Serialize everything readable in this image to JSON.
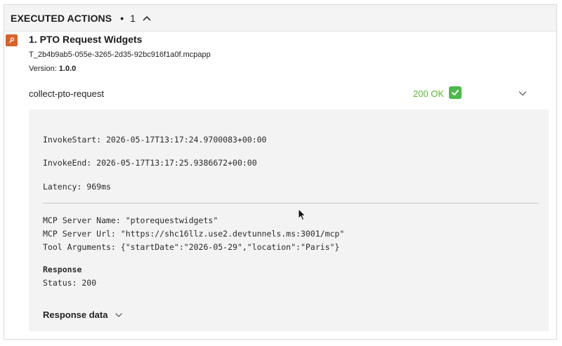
{
  "header": {
    "title": "EXECUTED ACTIONS",
    "dot": "•",
    "count": "1"
  },
  "app": {
    "title": "1. PTO Request Widgets",
    "id": "T_2b4b9ab5-055e-3265-2d35-92bc916f1a0f.mcpapp",
    "version_label": "Version: ",
    "version_value": "1.0.0",
    "icon": "orange-app-icon"
  },
  "action": {
    "name": "collect-pto-request",
    "status": "200 OK",
    "status_color": "#5db73a"
  },
  "details": {
    "invoke_start": "InvokeStart: 2026-05-17T13:17:24.9700083+00:00",
    "invoke_end": "InvokeEnd: 2026-05-17T13:17:25.9386672+00:00",
    "latency": "Latency: 969ms",
    "server_name": "MCP Server Name: \"ptorequestwidgets\"",
    "server_url": "MCP Server Url: \"https://shc16llz.use2.devtunnels.ms:3001/mcp\"",
    "tool_args": "Tool Arguments: {\"startDate\":\"2026-05-29\",\"location\":\"Paris\"}",
    "response_label": "Response",
    "status_line": "Status: 200",
    "response_data_label": "Response data"
  }
}
